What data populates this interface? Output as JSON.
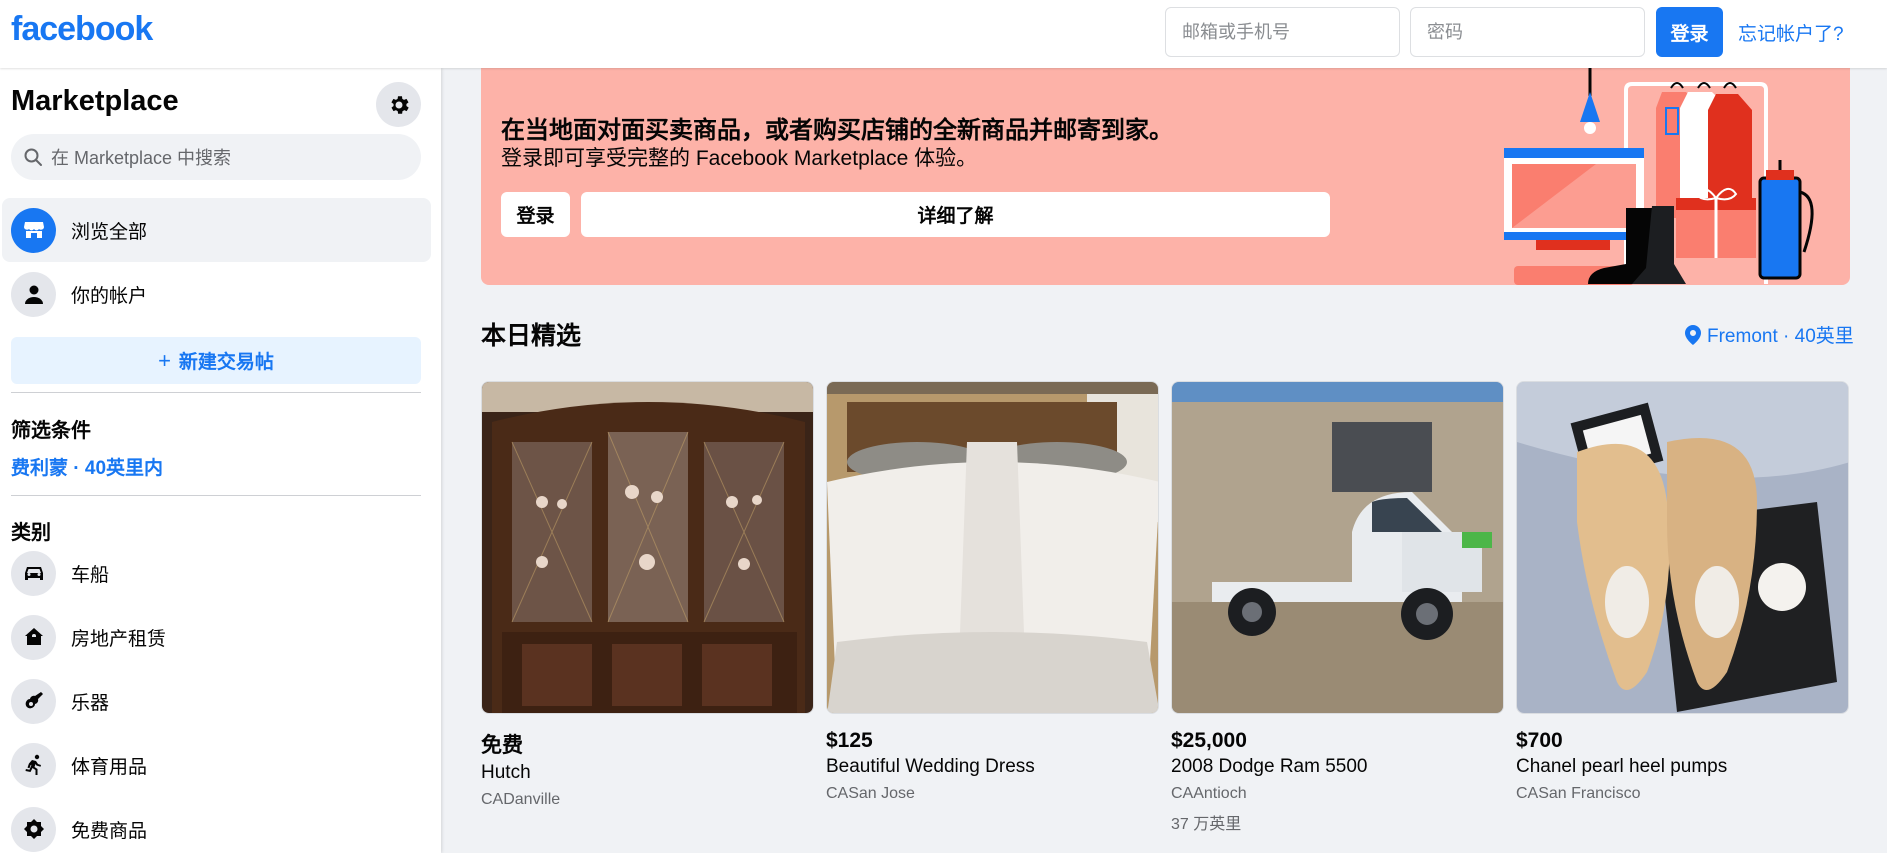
{
  "header": {
    "logo": "facebook",
    "email_placeholder": "邮箱或手机号",
    "password_placeholder": "密码",
    "login_label": "登录",
    "forgot_label": "忘记帐户了?"
  },
  "sidebar": {
    "title": "Marketplace",
    "search_placeholder": "在 Marketplace 中搜索",
    "nav": [
      {
        "label": "浏览全部",
        "icon": "storefront-icon"
      },
      {
        "label": "你的帐户",
        "icon": "user-icon"
      }
    ],
    "new_listing_label": "新建交易帖",
    "filters_heading": "筛选条件",
    "filter_location": "费利蒙 · 40英里内",
    "categories_heading": "类别",
    "categories": [
      {
        "label": "车船",
        "icon": "car-icon"
      },
      {
        "label": "房地产租赁",
        "icon": "house-icon"
      },
      {
        "label": "乐器",
        "icon": "guitar-icon"
      },
      {
        "label": "体育用品",
        "icon": "running-icon"
      },
      {
        "label": "免费商品",
        "icon": "free-tag-icon"
      }
    ]
  },
  "banner": {
    "title": "在当地面对面买卖商品，或者购买店铺的全新商品并邮寄到家。",
    "subtitle": "登录即可享受完整的 Facebook Marketplace 体验。",
    "login_label": "登录",
    "learn_more_label": "详细了解"
  },
  "main": {
    "section_title": "本日精选",
    "location_label": "Fremont · 40英里",
    "listings": [
      {
        "price": "免费",
        "title": "Hutch",
        "location": "CADanville",
        "distance": ""
      },
      {
        "price": "$125",
        "title": "Beautiful Wedding Dress",
        "location": "CASan Jose",
        "distance": ""
      },
      {
        "price": "$25,000",
        "title": "2008 Dodge Ram 5500",
        "location": "CAAntioch",
        "distance": "37 万英里"
      },
      {
        "price": "$700",
        "title": "Chanel pearl heel pumps",
        "location": "CASan Francisco",
        "distance": ""
      }
    ]
  },
  "colors": {
    "brand": "#1877f2",
    "banner_bg": "#fdb2a8",
    "page_bg": "#f0f2f5"
  }
}
